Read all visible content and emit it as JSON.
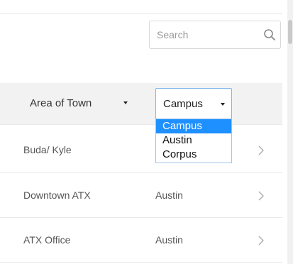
{
  "search": {
    "placeholder": "Search"
  },
  "table": {
    "area_header": "Area of Town",
    "city_filter": {
      "selected": "Campus",
      "options": [
        "Campus",
        "Austin",
        "Corpus"
      ]
    },
    "rows": [
      {
        "area": "Buda/ Kyle",
        "city": ""
      },
      {
        "area": "Downtown ATX",
        "city": "Austin"
      },
      {
        "area": "ATX Office",
        "city": "Austin"
      }
    ]
  },
  "colors": {
    "selected_option": "#1e90ff",
    "header_bg": "#f2f2f2",
    "focus_border": "#7fb6ea"
  },
  "icons": {
    "search": "search-icon",
    "sort": "caret-down-icon",
    "row": "chevron-right-icon"
  }
}
